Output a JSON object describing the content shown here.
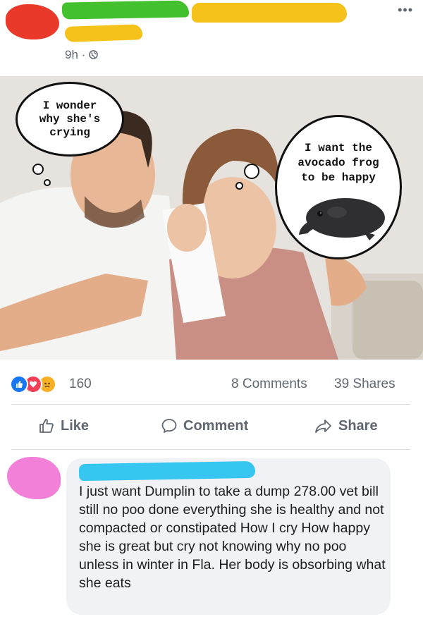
{
  "post": {
    "timestamp": "9h ·",
    "more_label": "•••"
  },
  "meme": {
    "bubble_left": "I wonder\nwhy she's\ncrying",
    "bubble_right": "I want the\navocado frog\nto be happy"
  },
  "stats": {
    "reactions_count": "160",
    "comments": "8 Comments",
    "shares": "39 Shares"
  },
  "actions": {
    "like": "Like",
    "comment": "Comment",
    "share": "Share"
  },
  "comment": {
    "text": "I just want Dumplin to take a dump 278.00 vet bill still no poo done everything she is healthy and not compacted or constipated How I cry How happy she is great but cry not knowing why no poo unless in winter in Fla. Her body is obsorbing what she eats"
  },
  "colors": {
    "facebook_blue": "#1877f2",
    "love_red": "#f33e58",
    "sad_yellow": "#f7b125"
  }
}
